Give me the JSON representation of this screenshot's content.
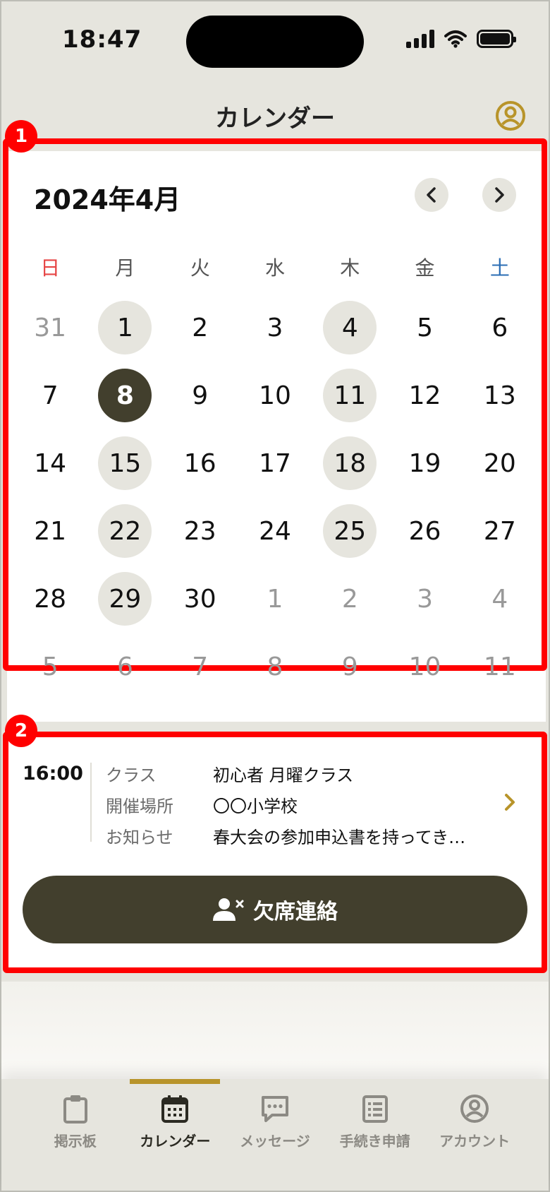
{
  "status_bar": {
    "time": "18:47"
  },
  "header": {
    "title": "カレンダー"
  },
  "markers": {
    "calendar": "1",
    "event": "2"
  },
  "calendar": {
    "month_label": "2024年4月",
    "weekdays": [
      "日",
      "月",
      "火",
      "水",
      "木",
      "金",
      "土"
    ],
    "weeks": [
      [
        {
          "d": "31",
          "dim": true
        },
        {
          "d": "1",
          "event": true
        },
        {
          "d": "2"
        },
        {
          "d": "3"
        },
        {
          "d": "4",
          "event": true
        },
        {
          "d": "5"
        },
        {
          "d": "6"
        }
      ],
      [
        {
          "d": "7"
        },
        {
          "d": "8",
          "selected": true
        },
        {
          "d": "9"
        },
        {
          "d": "10"
        },
        {
          "d": "11",
          "event": true
        },
        {
          "d": "12"
        },
        {
          "d": "13"
        }
      ],
      [
        {
          "d": "14"
        },
        {
          "d": "15",
          "event": true
        },
        {
          "d": "16"
        },
        {
          "d": "17"
        },
        {
          "d": "18",
          "event": true
        },
        {
          "d": "19"
        },
        {
          "d": "20"
        }
      ],
      [
        {
          "d": "21"
        },
        {
          "d": "22",
          "event": true
        },
        {
          "d": "23"
        },
        {
          "d": "24"
        },
        {
          "d": "25",
          "event": true
        },
        {
          "d": "26"
        },
        {
          "d": "27"
        }
      ],
      [
        {
          "d": "28"
        },
        {
          "d": "29",
          "event": true
        },
        {
          "d": "30"
        },
        {
          "d": "1",
          "dim": true
        },
        {
          "d": "2",
          "dim": true
        },
        {
          "d": "3",
          "dim": true
        },
        {
          "d": "4",
          "dim": true
        }
      ],
      [
        {
          "d": "5",
          "dim": true
        },
        {
          "d": "6",
          "dim": true
        },
        {
          "d": "7",
          "dim": true
        },
        {
          "d": "8",
          "dim": true
        },
        {
          "d": "9",
          "dim": true
        },
        {
          "d": "10",
          "dim": true
        },
        {
          "d": "11",
          "dim": true
        }
      ]
    ]
  },
  "event": {
    "time": "16:00",
    "rows": [
      {
        "label": "クラス",
        "value": "初心者 月曜クラス"
      },
      {
        "label": "開催場所",
        "value": "〇〇小学校"
      },
      {
        "label": "お知らせ",
        "value": "春大会の参加申込書を持ってき…"
      }
    ],
    "absence_button": "欠席連絡"
  },
  "tabs": [
    {
      "label": "掲示板",
      "icon": "clipboard-icon",
      "active": false
    },
    {
      "label": "カレンダー",
      "icon": "calendar-icon",
      "active": true
    },
    {
      "label": "メッセージ",
      "icon": "message-icon",
      "active": false
    },
    {
      "label": "手続き申請",
      "icon": "form-list-icon",
      "active": false
    },
    {
      "label": "アカウント",
      "icon": "account-icon",
      "active": false
    }
  ],
  "colors": {
    "accent": "#b8942a",
    "dark": "#423f2d",
    "highlight": "#ff0000",
    "background": "#e6e5de",
    "sunday": "#e64545",
    "saturday": "#2a6db4"
  }
}
